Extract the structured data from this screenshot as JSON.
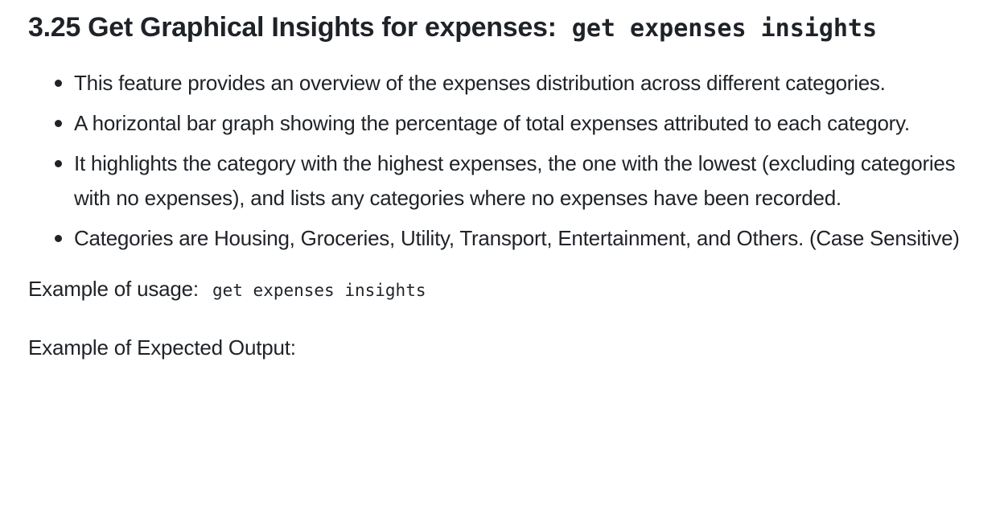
{
  "heading": {
    "text": "3.25 Get Graphical Insights for expenses:",
    "code": "get expenses insights"
  },
  "bullets": [
    "This feature provides an overview of the expenses distribution across different categories.",
    "A horizontal bar graph showing the percentage of total expenses attributed to each category.",
    "It highlights the category with the highest expenses, the one with the lowest (excluding categories with no expenses), and lists any categories where no expenses have been recorded.",
    "Categories are Housing, Groceries, Utility, Transport, Entertainment, and Others. (Case Sensitive)"
  ],
  "usage": {
    "label": "Example of usage:",
    "code": "get expenses insights"
  },
  "expected_output": {
    "label": "Example of Expected Output:"
  }
}
